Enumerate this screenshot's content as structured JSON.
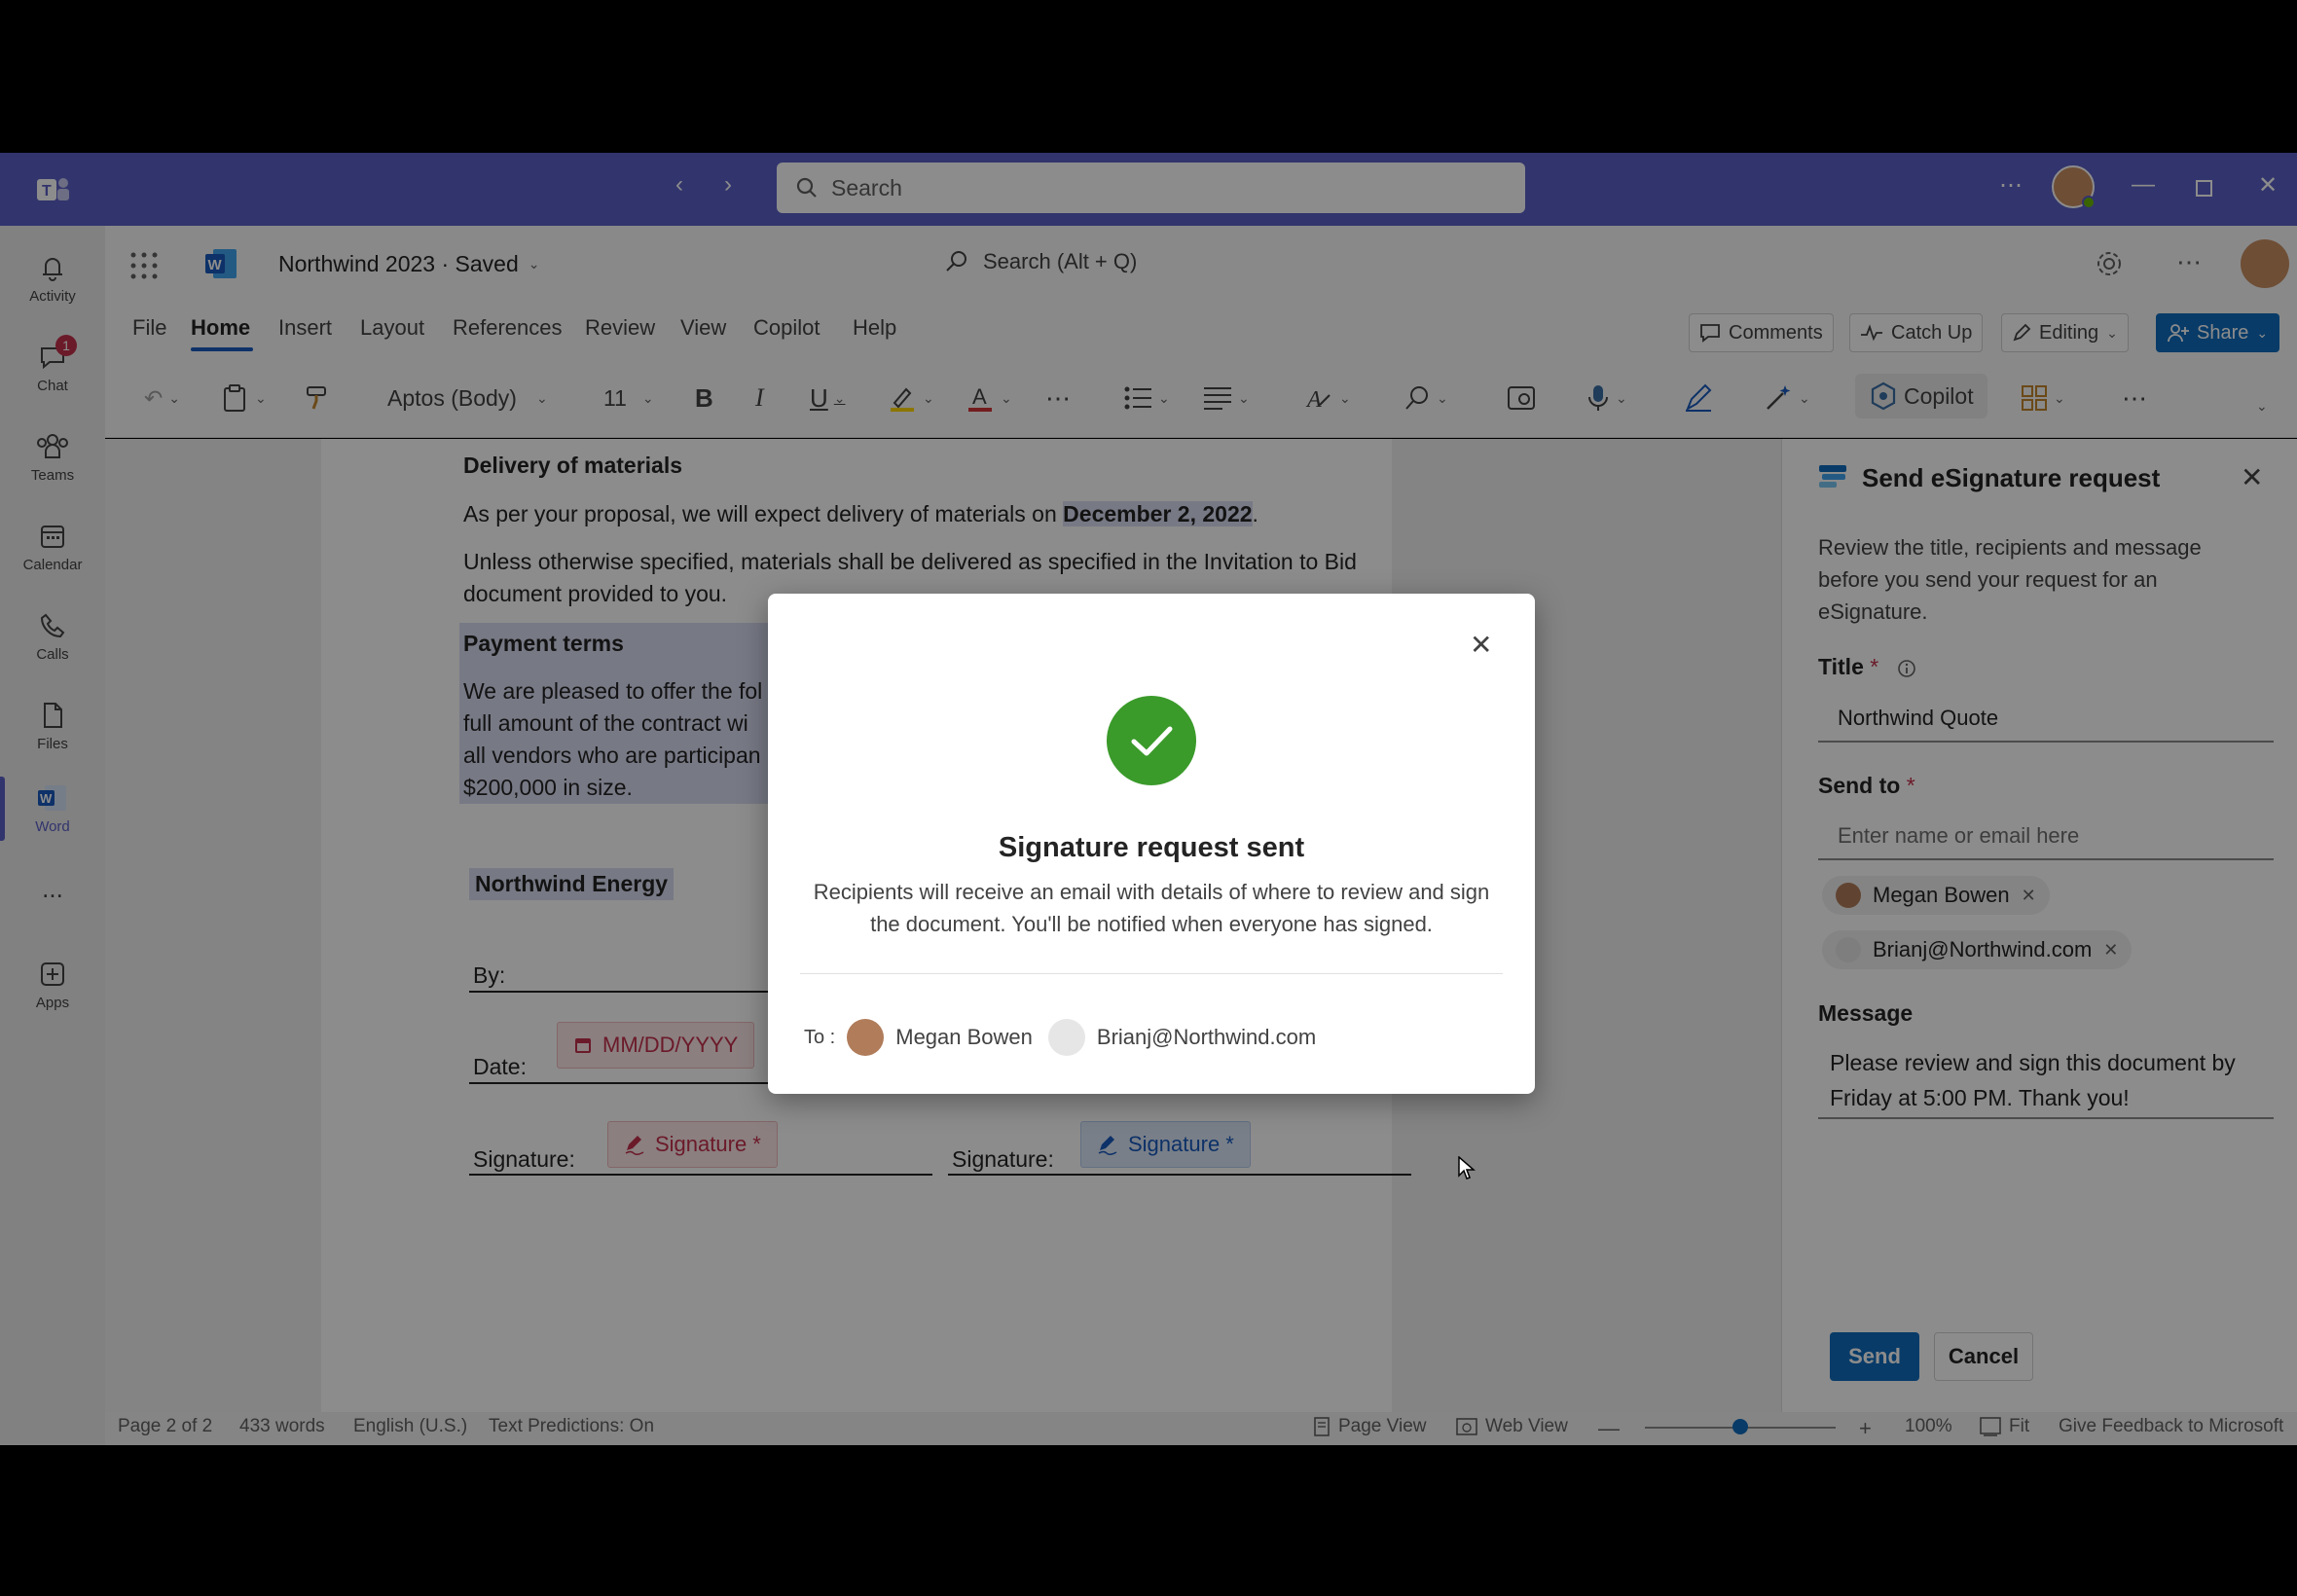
{
  "teams": {
    "search_placeholder": "Search",
    "rail": [
      {
        "label": "Activity",
        "icon": "bell-icon"
      },
      {
        "label": "Chat",
        "icon": "chat-icon",
        "badge": "1"
      },
      {
        "label": "Teams",
        "icon": "teams-icon"
      },
      {
        "label": "Calendar",
        "icon": "calendar-icon"
      },
      {
        "label": "Calls",
        "icon": "phone-icon"
      },
      {
        "label": "Files",
        "icon": "file-icon"
      },
      {
        "label": "Word",
        "icon": "word-icon"
      },
      {
        "label": "...",
        "icon": "more-icon"
      },
      {
        "label": "Apps",
        "icon": "add-app-icon"
      }
    ]
  },
  "word": {
    "doc_title": "Northwind 2023 · Saved",
    "search_placeholder": "Search (Alt + Q)",
    "tabs": [
      "File",
      "Home",
      "Insert",
      "Layout",
      "References",
      "Review",
      "View",
      "Copilot",
      "Help"
    ],
    "active_tab": "Home",
    "buttons": {
      "comments": "Comments",
      "catch_up": "Catch Up",
      "editing": "Editing",
      "share": "Share"
    },
    "toolbar": {
      "font": "Aptos (Body)",
      "size": "11",
      "copilot": "Copilot"
    }
  },
  "document": {
    "h_delivery": "Delivery of materials",
    "p_delivery_a": "As per your proposal, we will expect delivery of materials on ",
    "p_delivery_date": "December 2, 2022",
    "p_delivery_b": ".",
    "p_unless_1": "Unless otherwise specified, materials shall be delivered as specified in the Invitation to Bid",
    "p_unless_2": "document provided to you.",
    "h_payment": "Payment terms",
    "p_pay_1": "We are pleased to offer the fol",
    "p_pay_2": "full amount of the contract wi",
    "p_pay_3": "all vendors who are participan",
    "p_pay_4": "$200,000 in size.",
    "company": "Northwind Energy",
    "by_label": "By:",
    "date_label": "Date:",
    "date_field": "MM/DD/YYYY",
    "sig_label_1": "Signature:",
    "sig_label_2": "Signature:",
    "sig_field_1": "Signature *",
    "sig_field_2": "Signature *"
  },
  "panel": {
    "title": "Send eSignature request",
    "intro": "Review the title, recipients and message before you send your request for an eSignature.",
    "title_label": "Title",
    "title_value": "Northwind Quote",
    "sendto_label": "Send to",
    "sendto_placeholder": "Enter name or email here",
    "recipients": [
      "Megan Bowen",
      "Brianj@Northwind.com"
    ],
    "message_label": "Message",
    "message_value": "Please review and sign this document by Friday at 5:00 PM. Thank you!",
    "send": "Send",
    "cancel": "Cancel",
    "required_mark": "*"
  },
  "dialog": {
    "title": "Signature request sent",
    "body": "Recipients will receive an email with details of where to review and sign the document. You'll be notified when everyone has signed.",
    "to_label": "To :",
    "to_recipients": [
      "Megan Bowen",
      "Brianj@Northwind.com"
    ],
    "success_color": "#3a9a2a"
  },
  "status": {
    "page": "Page 2 of 2",
    "words": "433 words",
    "language": "English (U.S.)",
    "predictions": "Text Predictions: On",
    "page_view": "Page View",
    "web_view": "Web View",
    "zoom": "100%",
    "zoom_level": 0.5,
    "fit": "Fit",
    "feedback": "Give Feedback to Microsoft"
  },
  "colors": {
    "teams_purple": "#5b5fc7",
    "word_blue": "#185abd",
    "share_blue": "#0f6cbd"
  }
}
